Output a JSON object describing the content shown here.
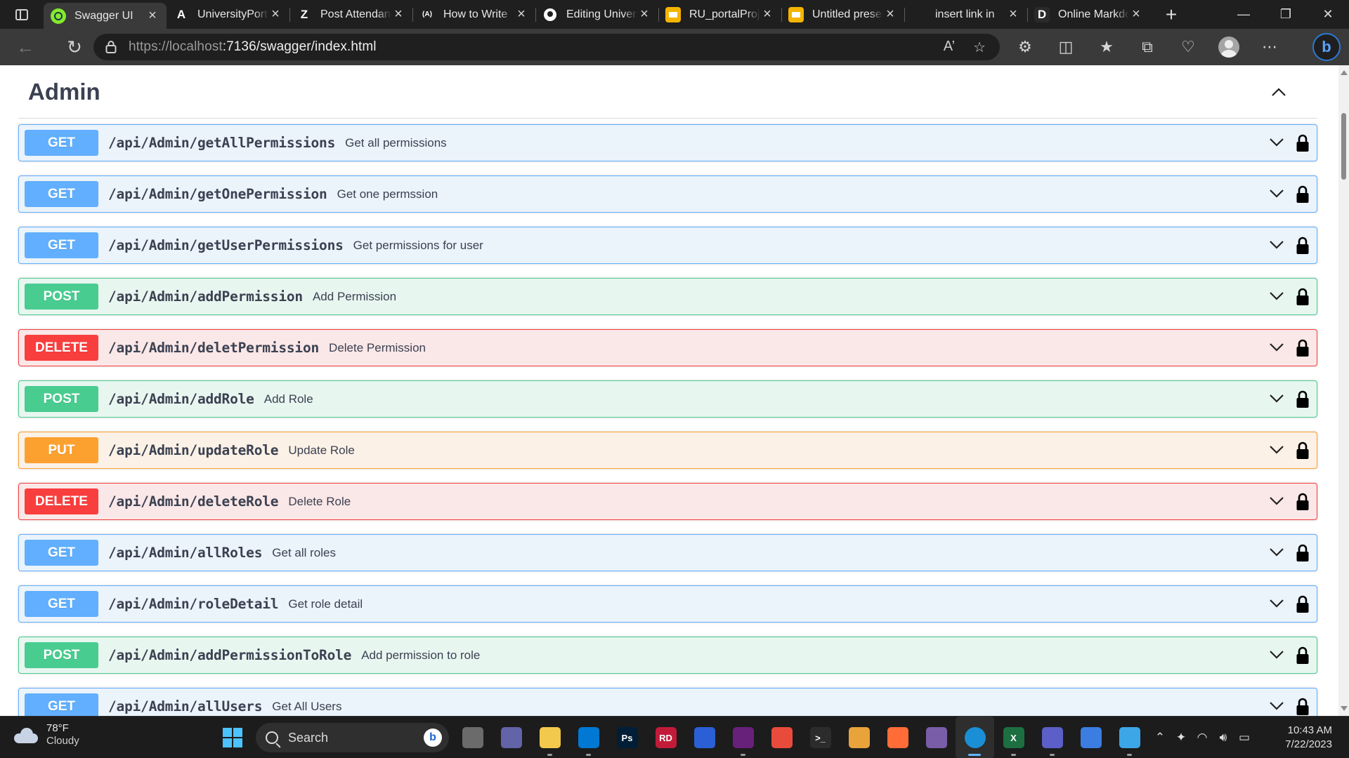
{
  "browser": {
    "tabs": [
      {
        "title": "Swagger UI",
        "favicon": "swagger-icon",
        "fav_color": "#85ea2d",
        "fav_text": "",
        "active": true
      },
      {
        "title": "UniversityPortal",
        "favicon": "angular-icon",
        "fav_color": "#1f1f1f",
        "fav_text": "A",
        "active": false
      },
      {
        "title": "Post Attendance",
        "favicon": "zoho-icon",
        "fav_color": "#1f1f1f",
        "fav_text": "Z",
        "active": false
      },
      {
        "title": "How to Write",
        "favicon": "ai-icon",
        "fav_color": "#1f1f1f",
        "fav_text": "(A)",
        "active": false
      },
      {
        "title": "Editing University",
        "favicon": "github-icon",
        "fav_color": "#1f1f1f",
        "fav_text": "",
        "active": false
      },
      {
        "title": "RU_portalProject",
        "favicon": "slides-icon",
        "fav_color": "#f4b400",
        "fav_text": "",
        "active": false
      },
      {
        "title": "Untitled presentation",
        "favicon": "slides-icon",
        "fav_color": "#f4b400",
        "fav_text": "",
        "active": false
      },
      {
        "title": "insert link in",
        "favicon": "blank-icon",
        "fav_color": "#1f1f1f",
        "fav_text": "",
        "active": false
      },
      {
        "title": "Online Markdown",
        "favicon": "dillinger-icon",
        "fav_color": "#2a2a2a",
        "fav_text": "D",
        "active": false
      }
    ],
    "close_glyph": "×",
    "new_tab_glyph": "+",
    "url_host": "https://localhost",
    "url_rest": ":7136/swagger/index.html"
  },
  "section": {
    "title": "Admin"
  },
  "operations": [
    {
      "method": "GET",
      "path": "/api/Admin/getAllPermissions",
      "summary": "Get all permissions"
    },
    {
      "method": "GET",
      "path": "/api/Admin/getOnePermission",
      "summary": "Get one permssion"
    },
    {
      "method": "GET",
      "path": "/api/Admin/getUserPermissions",
      "summary": "Get permissions for user"
    },
    {
      "method": "POST",
      "path": "/api/Admin/addPermission",
      "summary": "Add Permission"
    },
    {
      "method": "DELETE",
      "path": "/api/Admin/deletPermission",
      "summary": "Delete Permission"
    },
    {
      "method": "POST",
      "path": "/api/Admin/addRole",
      "summary": "Add Role"
    },
    {
      "method": "PUT",
      "path": "/api/Admin/updateRole",
      "summary": "Update Role"
    },
    {
      "method": "DELETE",
      "path": "/api/Admin/deleteRole",
      "summary": "Delete Role"
    },
    {
      "method": "GET",
      "path": "/api/Admin/allRoles",
      "summary": "Get all roles"
    },
    {
      "method": "GET",
      "path": "/api/Admin/roleDetail",
      "summary": "Get role detail"
    },
    {
      "method": "POST",
      "path": "/api/Admin/addPermissionToRole",
      "summary": "Add permission to role"
    },
    {
      "method": "GET",
      "path": "/api/Admin/allUsers",
      "summary": "Get All Users"
    }
  ],
  "method_colors": {
    "GET": "#61affe",
    "POST": "#49cc90",
    "DELETE": "#f93e3e",
    "PUT": "#fca130"
  },
  "taskbar": {
    "weather_temp": "78°F",
    "weather_desc": "Cloudy",
    "search_label": "Search",
    "apps": [
      {
        "name": "task-view",
        "color": "#6b6b6b",
        "label": "",
        "run": false
      },
      {
        "name": "teams-chat",
        "color": "#6264a7",
        "label": "",
        "run": false
      },
      {
        "name": "file-explorer",
        "color": "#f2c94c",
        "label": "",
        "run": true
      },
      {
        "name": "vscode",
        "color": "#0078d4",
        "label": "",
        "run": true
      },
      {
        "name": "photoshop",
        "color": "#001e36",
        "label": "Ps",
        "run": false
      },
      {
        "name": "rider",
        "color": "#c21b3a",
        "label": "RD",
        "run": false
      },
      {
        "name": "whiteboard",
        "color": "#2b5fd6",
        "label": "",
        "run": false
      },
      {
        "name": "visual-studio",
        "color": "#68217a",
        "label": "",
        "run": true
      },
      {
        "name": "capcut",
        "color": "#e84b3c",
        "label": "",
        "run": false
      },
      {
        "name": "terminal",
        "color": "#2c2c2c",
        "label": ">_",
        "run": false
      },
      {
        "name": "paint",
        "color": "#e8a33b",
        "label": "",
        "run": false
      },
      {
        "name": "postman",
        "color": "#ff6c37",
        "label": "",
        "run": false
      },
      {
        "name": "winrar",
        "color": "#7a5da8",
        "label": "",
        "run": false
      },
      {
        "name": "edge",
        "color": "#1a8fd6",
        "label": "",
        "run": true,
        "active": true
      },
      {
        "name": "excel",
        "color": "#1d6f42",
        "label": "X",
        "run": true
      },
      {
        "name": "teams",
        "color": "#5b5fc7",
        "label": "",
        "run": true
      },
      {
        "name": "calendar",
        "color": "#3b7de0",
        "label": "",
        "run": false
      },
      {
        "name": "notepad",
        "color": "#3da6e6",
        "label": "",
        "run": true
      }
    ],
    "time": "10:43 AM",
    "date": "7/22/2023"
  }
}
